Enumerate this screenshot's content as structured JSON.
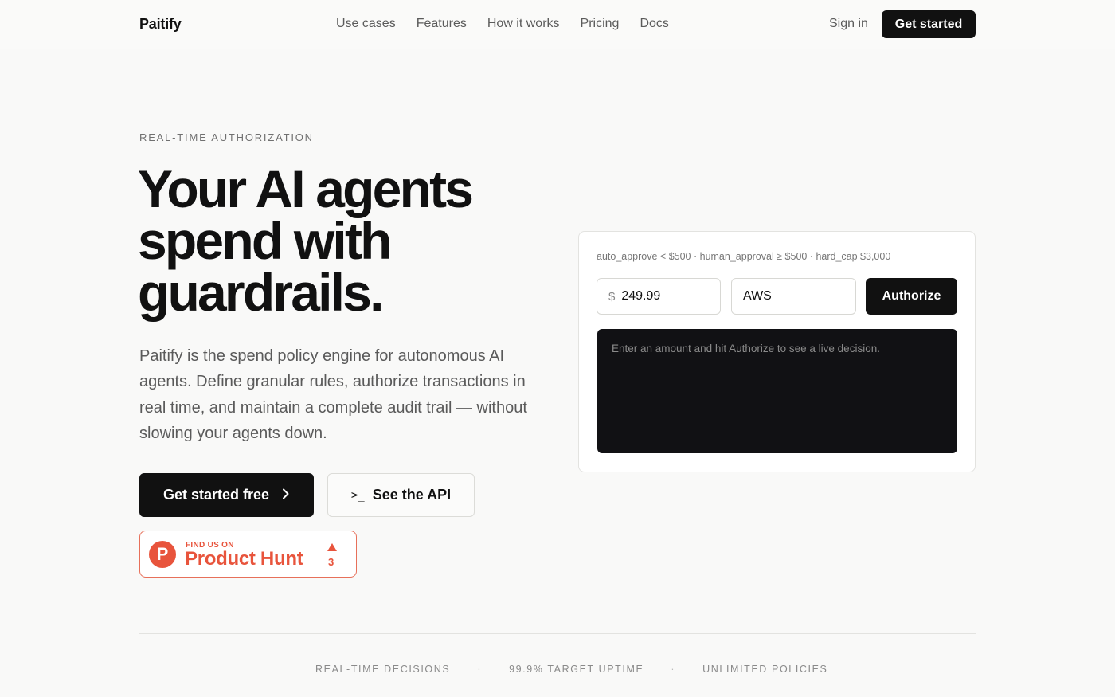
{
  "header": {
    "brand": "Paitify",
    "nav": [
      "Use cases",
      "Features",
      "How it works",
      "Pricing",
      "Docs"
    ],
    "sign_in": "Sign in",
    "cta": "Get started"
  },
  "hero": {
    "eyebrow": "REAL-TIME AUTHORIZATION",
    "headline_lines": [
      "Your AI agents",
      "spend with",
      "guardrails."
    ],
    "lede": "Paitify is the spend policy engine for autonomous AI agents. Define granular rules, authorize transactions in real time, and maintain a complete audit trail — without slowing your agents down.",
    "primary_cta": "Get started free",
    "secondary_cta": "See the API",
    "terminal_glyph": ">_"
  },
  "product_hunt": {
    "logo_letter": "P",
    "kicker": "FIND US ON",
    "name": "Product Hunt",
    "votes": "3"
  },
  "demo": {
    "policy": "auto_approve < $500 · human_approval ≥ $500 · hard_cap $3,000",
    "currency": "$",
    "amount": "249.99",
    "vendor": "AWS",
    "authorize": "Authorize",
    "console_placeholder": "Enter an amount and hit Authorize to see a live decision."
  },
  "stats": [
    "REAL-TIME DECISIONS",
    "99.9% TARGET UPTIME",
    "UNLIMITED POLICIES"
  ],
  "stats_separator": "·",
  "colors": {
    "background": "#f9f9f8",
    "primary": "#111111",
    "product_hunt": "#e8543c",
    "console": "#111114"
  }
}
